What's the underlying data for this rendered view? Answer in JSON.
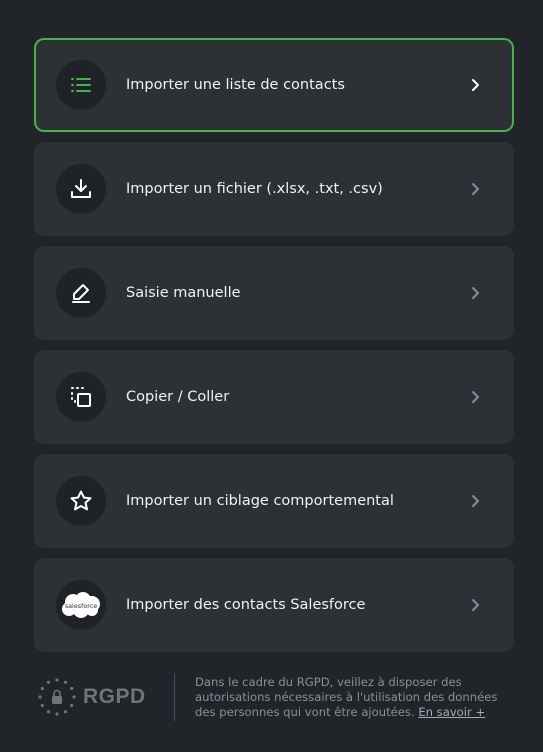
{
  "options": [
    {
      "label": "Importer une liste de contacts",
      "icon": "list-icon",
      "selected": true
    },
    {
      "label": "Importer un fichier (.xlsx, .txt, .csv)",
      "icon": "download-icon",
      "selected": false
    },
    {
      "label": "Saisie manuelle",
      "icon": "pen-icon",
      "selected": false
    },
    {
      "label": "Copier / Coller",
      "icon": "copy-paste-icon",
      "selected": false
    },
    {
      "label": "Importer un ciblage comportemental",
      "icon": "star-icon",
      "selected": false
    },
    {
      "label": "Importer des contacts Salesforce",
      "icon": "salesforce-logo",
      "selected": false
    }
  ],
  "salesforce_logo_text": "salesforce",
  "footer": {
    "logo_text": "RGPD",
    "notice": "Dans le cadre du RGPD, veillez à disposer des autorisations nécessaires à l'utilisation des données des personnes qui vont être ajoutées.",
    "link": "En savoir +"
  },
  "colors": {
    "background": "#212428",
    "card": "#2d3136",
    "selected_border": "#45b24a",
    "accent": "#45b24a"
  }
}
